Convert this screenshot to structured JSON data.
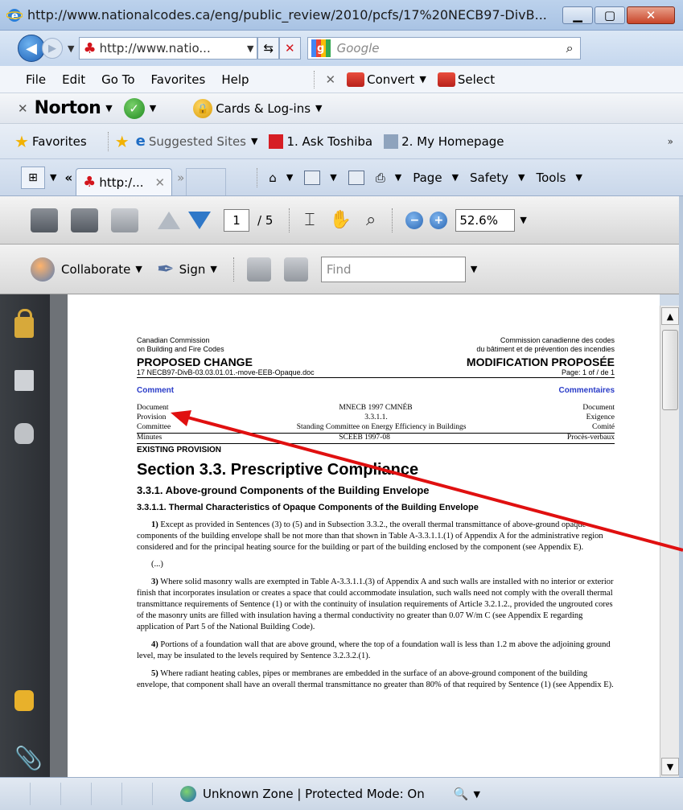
{
  "window": {
    "title": "http://www.nationalcodes.ca/eng/public_review/2010/pcfs/17%20NECB97-DivB..."
  },
  "nav": {
    "address": "http://www.natio...",
    "search_placeholder": "Google",
    "search_brand": "g"
  },
  "menu": {
    "items": [
      "File",
      "Edit",
      "Go To",
      "Favorites",
      "Help"
    ],
    "close": "✕",
    "convert": "Convert",
    "select": "Select"
  },
  "norton": {
    "close": "✕",
    "logo": "Norton",
    "cards": "Cards & Log-ins"
  },
  "favorites": {
    "label": "Favorites",
    "suggested": "Suggested Sites",
    "ask_toshiba": "1. Ask Toshiba",
    "my_homepage": "2. My Homepage"
  },
  "tabs": {
    "grid": "⊞",
    "back": "«",
    "active_tab": "http:/...",
    "more": "»",
    "page": "Page",
    "safety": "Safety",
    "tools": "Tools"
  },
  "acrobat": {
    "page_current": "1",
    "page_total": "/ 5",
    "zoom": "52.6%",
    "collaborate": "Collaborate",
    "sign": "Sign",
    "find_placeholder": "Find"
  },
  "document": {
    "org_en_1": "Canadian Commission",
    "org_en_2": "on Building and Fire Codes",
    "org_fr_1": "Commission canadienne des codes",
    "org_fr_2": "du bâtiment et de prévention des incendies",
    "proposed_change": "PROPOSED CHANGE",
    "modification": "MODIFICATION PROPOSÉE",
    "file": "17 NECB97-DivB-03.03.01.01.-move-EEB-Opaque.doc",
    "page": "Page: 1 of / de 1",
    "comment": "Comment",
    "commentaires": "Commentaires",
    "meta": [
      {
        "left": "Document",
        "mid": "MNECB 1997 CMNÉB",
        "right": "Document"
      },
      {
        "left": "Provision",
        "mid": "3.3.1.1.",
        "right": "Exigence"
      },
      {
        "left": "Committee",
        "mid": "Standing Committee on Energy Efficiency in Buildings",
        "right": "Comité"
      },
      {
        "left": "Minutes",
        "mid": "SCEEB 1997-08",
        "right": "Procès-verbaux"
      }
    ],
    "existing": "EXISTING PROVISION",
    "section": "Section 3.3. Prescriptive Compliance",
    "h331": "3.3.1. Above-ground Components of the Building Envelope",
    "h3311": "3.3.1.1. Thermal Characteristics of Opaque Components of the Building Envelope",
    "p1_num": "1)",
    "p1": "Except as provided in Sentences (3) to (5) and in Subsection 3.3.2., the overall thermal transmittance of above-ground opaque components of the building envelope shall be not more than that shown in Table A-3.3.1.1.(1) of Appendix A for the administrative region considered and for the principal heating source for the building or part of the building enclosed by the component (see Appendix E).",
    "ellipsis": "(...)",
    "p3_num": "3)",
    "p3": "Where solid masonry walls are exempted in Table A-3.3.1.1.(3) of Appendix A and such walls are installed with no interior or exterior finish that incorporates insulation or creates a space that could accommodate insulation, such walls need not comply with the overall thermal transmittance requirements of Sentence (1) or with the continuity of insulation requirements of Article 3.2.1.2., provided the ungrouted cores of the masonry units are filled with insulation having a thermal conductivity no greater than 0.07 W/m C (see Appendix E regarding application of Part 5 of the National Building Code).",
    "p4_num": "4)",
    "p4": "Portions of a foundation wall that are above ground, where the top of a foundation wall is less than 1.2 m above the adjoining ground level, may be insulated to the levels required by Sentence 3.2.3.2.(1).",
    "p5_num": "5)",
    "p5": "Where radiant heating cables, pipes or membranes are embedded in the surface of an above-ground component of the building envelope, that component shall have an overall thermal transmittance no greater than 80% of that required by Sentence (1) (see Appendix E)."
  },
  "status": {
    "zone": "Unknown Zone | Protected Mode: On",
    "zoom_icon": "🔍"
  },
  "colors": {
    "annotation_arrow": "#e01010",
    "link_blue": "#2a3cc8"
  }
}
